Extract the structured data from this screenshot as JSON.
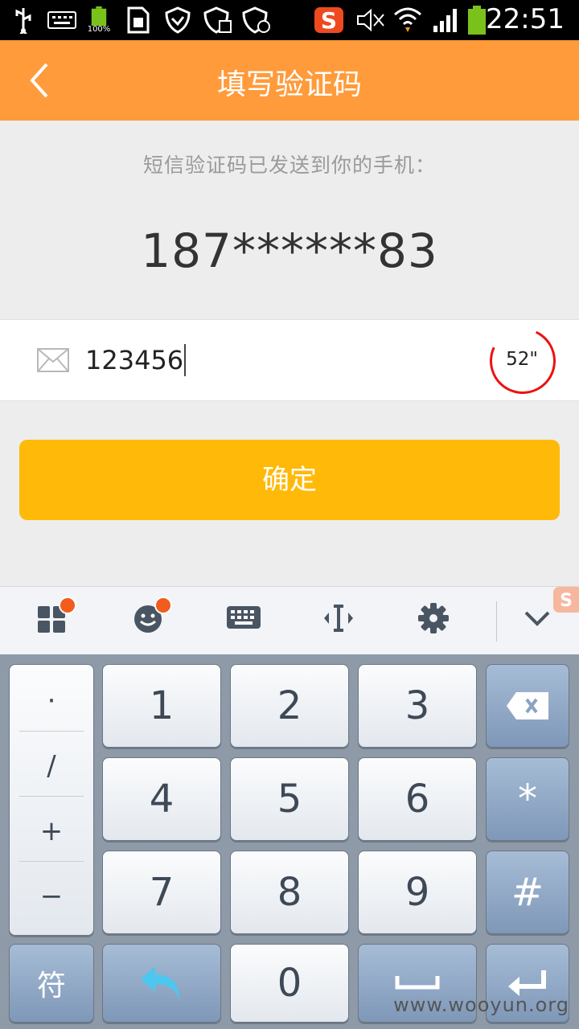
{
  "status_bar": {
    "time": "22:51",
    "battery_label": "100%",
    "icons": [
      "usb-icon",
      "keyboard-icon",
      "battery-full-icon",
      "sd-card-icon",
      "shield-icon",
      "shield-cube-icon",
      "shield-settings-icon",
      "sogou-icon",
      "mute-icon",
      "wifi-icon",
      "signal-icon",
      "battery-icon"
    ]
  },
  "header": {
    "title": "填写验证码",
    "back_icon": "chevron-left-icon"
  },
  "main": {
    "sent_text": "短信验证码已发送到你的手机：",
    "phone_masked": "187******83",
    "code_value": "123456",
    "timer": "52\"",
    "confirm_label": "确定"
  },
  "ime_toolbar": {
    "icons": [
      "grid-apps-icon",
      "emoji-icon",
      "keyboard-icon",
      "cursor-icon",
      "gear-icon",
      "chevron-down-icon"
    ],
    "colors": {
      "badge": "#f25c1d",
      "icon": "#4a5563"
    }
  },
  "keyboard": {
    "symbols": [
      "·",
      "/",
      "+",
      "−"
    ],
    "digits": [
      "1",
      "2",
      "3",
      "4",
      "5",
      "6",
      "7",
      "8",
      "9"
    ],
    "zero": "0",
    "sym_label": "符",
    "star": "*",
    "hash": "#"
  },
  "watermark": "www.wooyun.org",
  "colors": {
    "header": "#ff9b3b",
    "confirm": "#ffb908",
    "timer_ring": "#e11111"
  }
}
